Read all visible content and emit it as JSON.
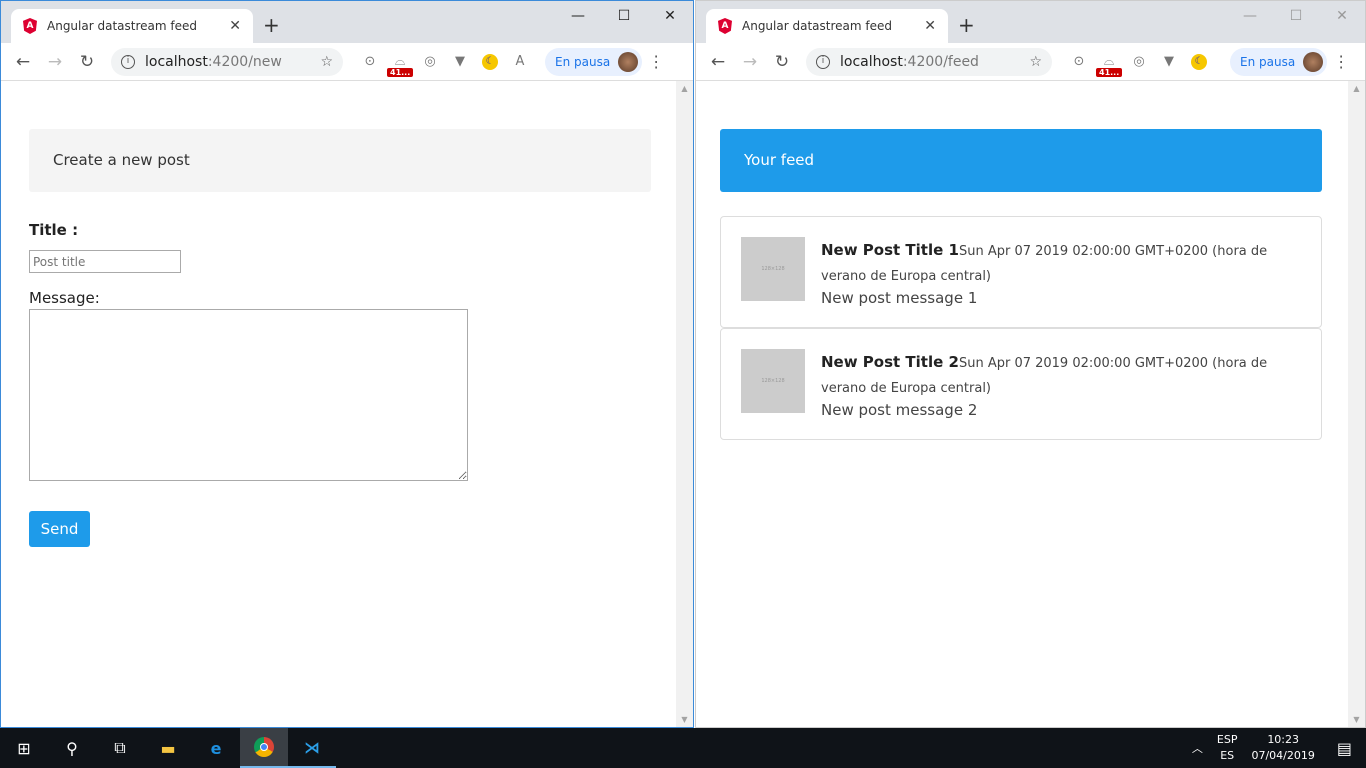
{
  "left": {
    "tab_title": "Angular datastream feed",
    "url_host": "localhost",
    "url_path": ":4200/new",
    "profile": "En pausa",
    "badge": "41..."
  },
  "right": {
    "tab_title": "Angular datastream feed",
    "url_host": "localhost",
    "url_path": ":4200/feed",
    "profile": "En pausa",
    "badge": "41..."
  },
  "form": {
    "heading": "Create a new post",
    "title_label": "Title :",
    "title_placeholder": "Post title",
    "message_label": "Message:",
    "send_label": "Send"
  },
  "feed": {
    "heading": "Your feed",
    "posts": [
      {
        "title": "New Post Title 1",
        "date": "Sun Apr 07 2019 02:00:00 GMT+0200 (hora de verano de Europa central)",
        "message": "New post message 1",
        "thumb": "128×128"
      },
      {
        "title": "New Post Title 2",
        "date": "Sun Apr 07 2019 02:00:00 GMT+0200 (hora de verano de Europa central)",
        "message": "New post message 2",
        "thumb": "128×128"
      }
    ]
  },
  "taskbar": {
    "lang1": "ESP",
    "lang2": "ES",
    "time": "10:23",
    "date": "07/04/2019"
  },
  "colors": {
    "accent": "#1e9bea",
    "angular": "#dd0031"
  }
}
